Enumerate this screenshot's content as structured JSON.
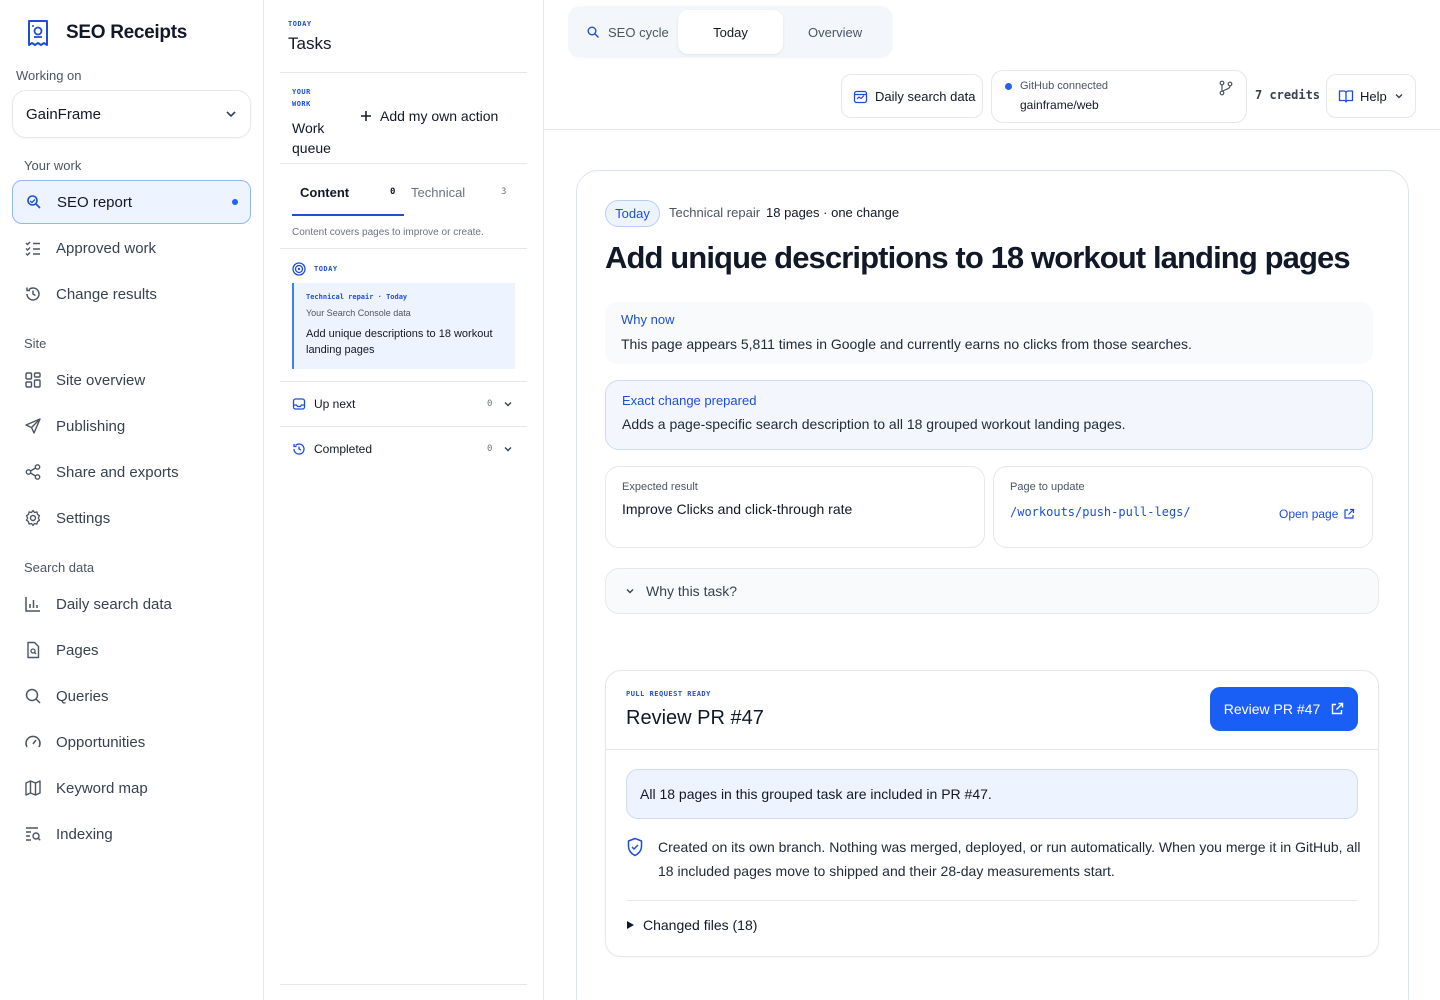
{
  "brand": {
    "name": "SEO Receipts"
  },
  "sidebar": {
    "working_on_label": "Working on",
    "project": "GainFrame",
    "sections": {
      "your_work": "Your work",
      "site": "Site",
      "search_data": "Search data"
    },
    "your_work_items": [
      {
        "label": "SEO report",
        "icon": "seo-cycle-icon",
        "active": true
      },
      {
        "label": "Approved work",
        "icon": "checklist-icon"
      },
      {
        "label": "Change results",
        "icon": "history-icon"
      }
    ],
    "site_items": [
      {
        "label": "Site overview",
        "icon": "grid-icon"
      },
      {
        "label": "Publishing",
        "icon": "send-icon"
      },
      {
        "label": "Share and exports",
        "icon": "share-icon"
      },
      {
        "label": "Settings",
        "icon": "gear-icon"
      }
    ],
    "search_items": [
      {
        "label": "Daily search data",
        "icon": "bar-chart-icon"
      },
      {
        "label": "Pages",
        "icon": "page-icon"
      },
      {
        "label": "Queries",
        "icon": "search-icon"
      },
      {
        "label": "Opportunities",
        "icon": "gauge-icon"
      },
      {
        "label": "Keyword map",
        "icon": "map-icon"
      },
      {
        "label": "Indexing",
        "icon": "indexing-icon"
      }
    ]
  },
  "tasks": {
    "eyebrow": "TODAY",
    "title": "Tasks",
    "queue_eyebrow": "YOUR WORK",
    "queue_title": "Work queue",
    "add_action": "Add my own action",
    "tabs": [
      {
        "label": "Content",
        "count": "0",
        "active": true
      },
      {
        "label": "Technical",
        "count": "3"
      }
    ],
    "tab_help": "Content covers pages to improve or create.",
    "today_label": "TODAY",
    "card": {
      "meta": "Technical repair · Today",
      "source": "Your Search Console data",
      "title": "Add unique descriptions to 18 workout landing pages"
    },
    "up_next": {
      "label": "Up next",
      "count": "0"
    },
    "completed": {
      "label": "Completed",
      "count": "0"
    }
  },
  "topbar": {
    "segments": [
      {
        "label": "SEO cycle"
      },
      {
        "label": "Today",
        "active": true
      },
      {
        "label": "Overview"
      }
    ],
    "daily_button": "Daily search data",
    "github_status": "GitHub connected",
    "github_repo": "gainframe/web",
    "credits": "7 credits",
    "help": "Help"
  },
  "main": {
    "pill": "Today",
    "category": "Technical repair",
    "scope": "18 pages · one change",
    "headline": "Add unique descriptions to 18 workout landing pages",
    "why_now_label": "Why now",
    "why_now_text": "This page appears 5,811 times in Google and currently earns no clicks from those searches.",
    "exact_label": "Exact change prepared",
    "exact_text": "Adds a page-specific search description to all 18 grouped workout landing pages.",
    "expected_label": "Expected result",
    "expected_value": "Improve Clicks and click-through rate",
    "page_label": "Page to update",
    "page_path": "/workouts/push-pull-legs/",
    "open_page": "Open page",
    "why_task": "Why this task?",
    "pr": {
      "eyebrow": "PULL REQUEST READY",
      "title": "Review PR #47",
      "button": "Review PR #47",
      "included": "All 18 pages in this grouped task are included in PR #47.",
      "branch_text": "Created on its own branch. Nothing was merged, deployed, or run automatically. When you merge it in GitHub, all 18 included pages move to shipped and their 28-day measurements start.",
      "changed_files": "Changed files (18)"
    }
  },
  "colors": {
    "accent": "#1a5ff5",
    "active_bg": "#eef4ff"
  }
}
